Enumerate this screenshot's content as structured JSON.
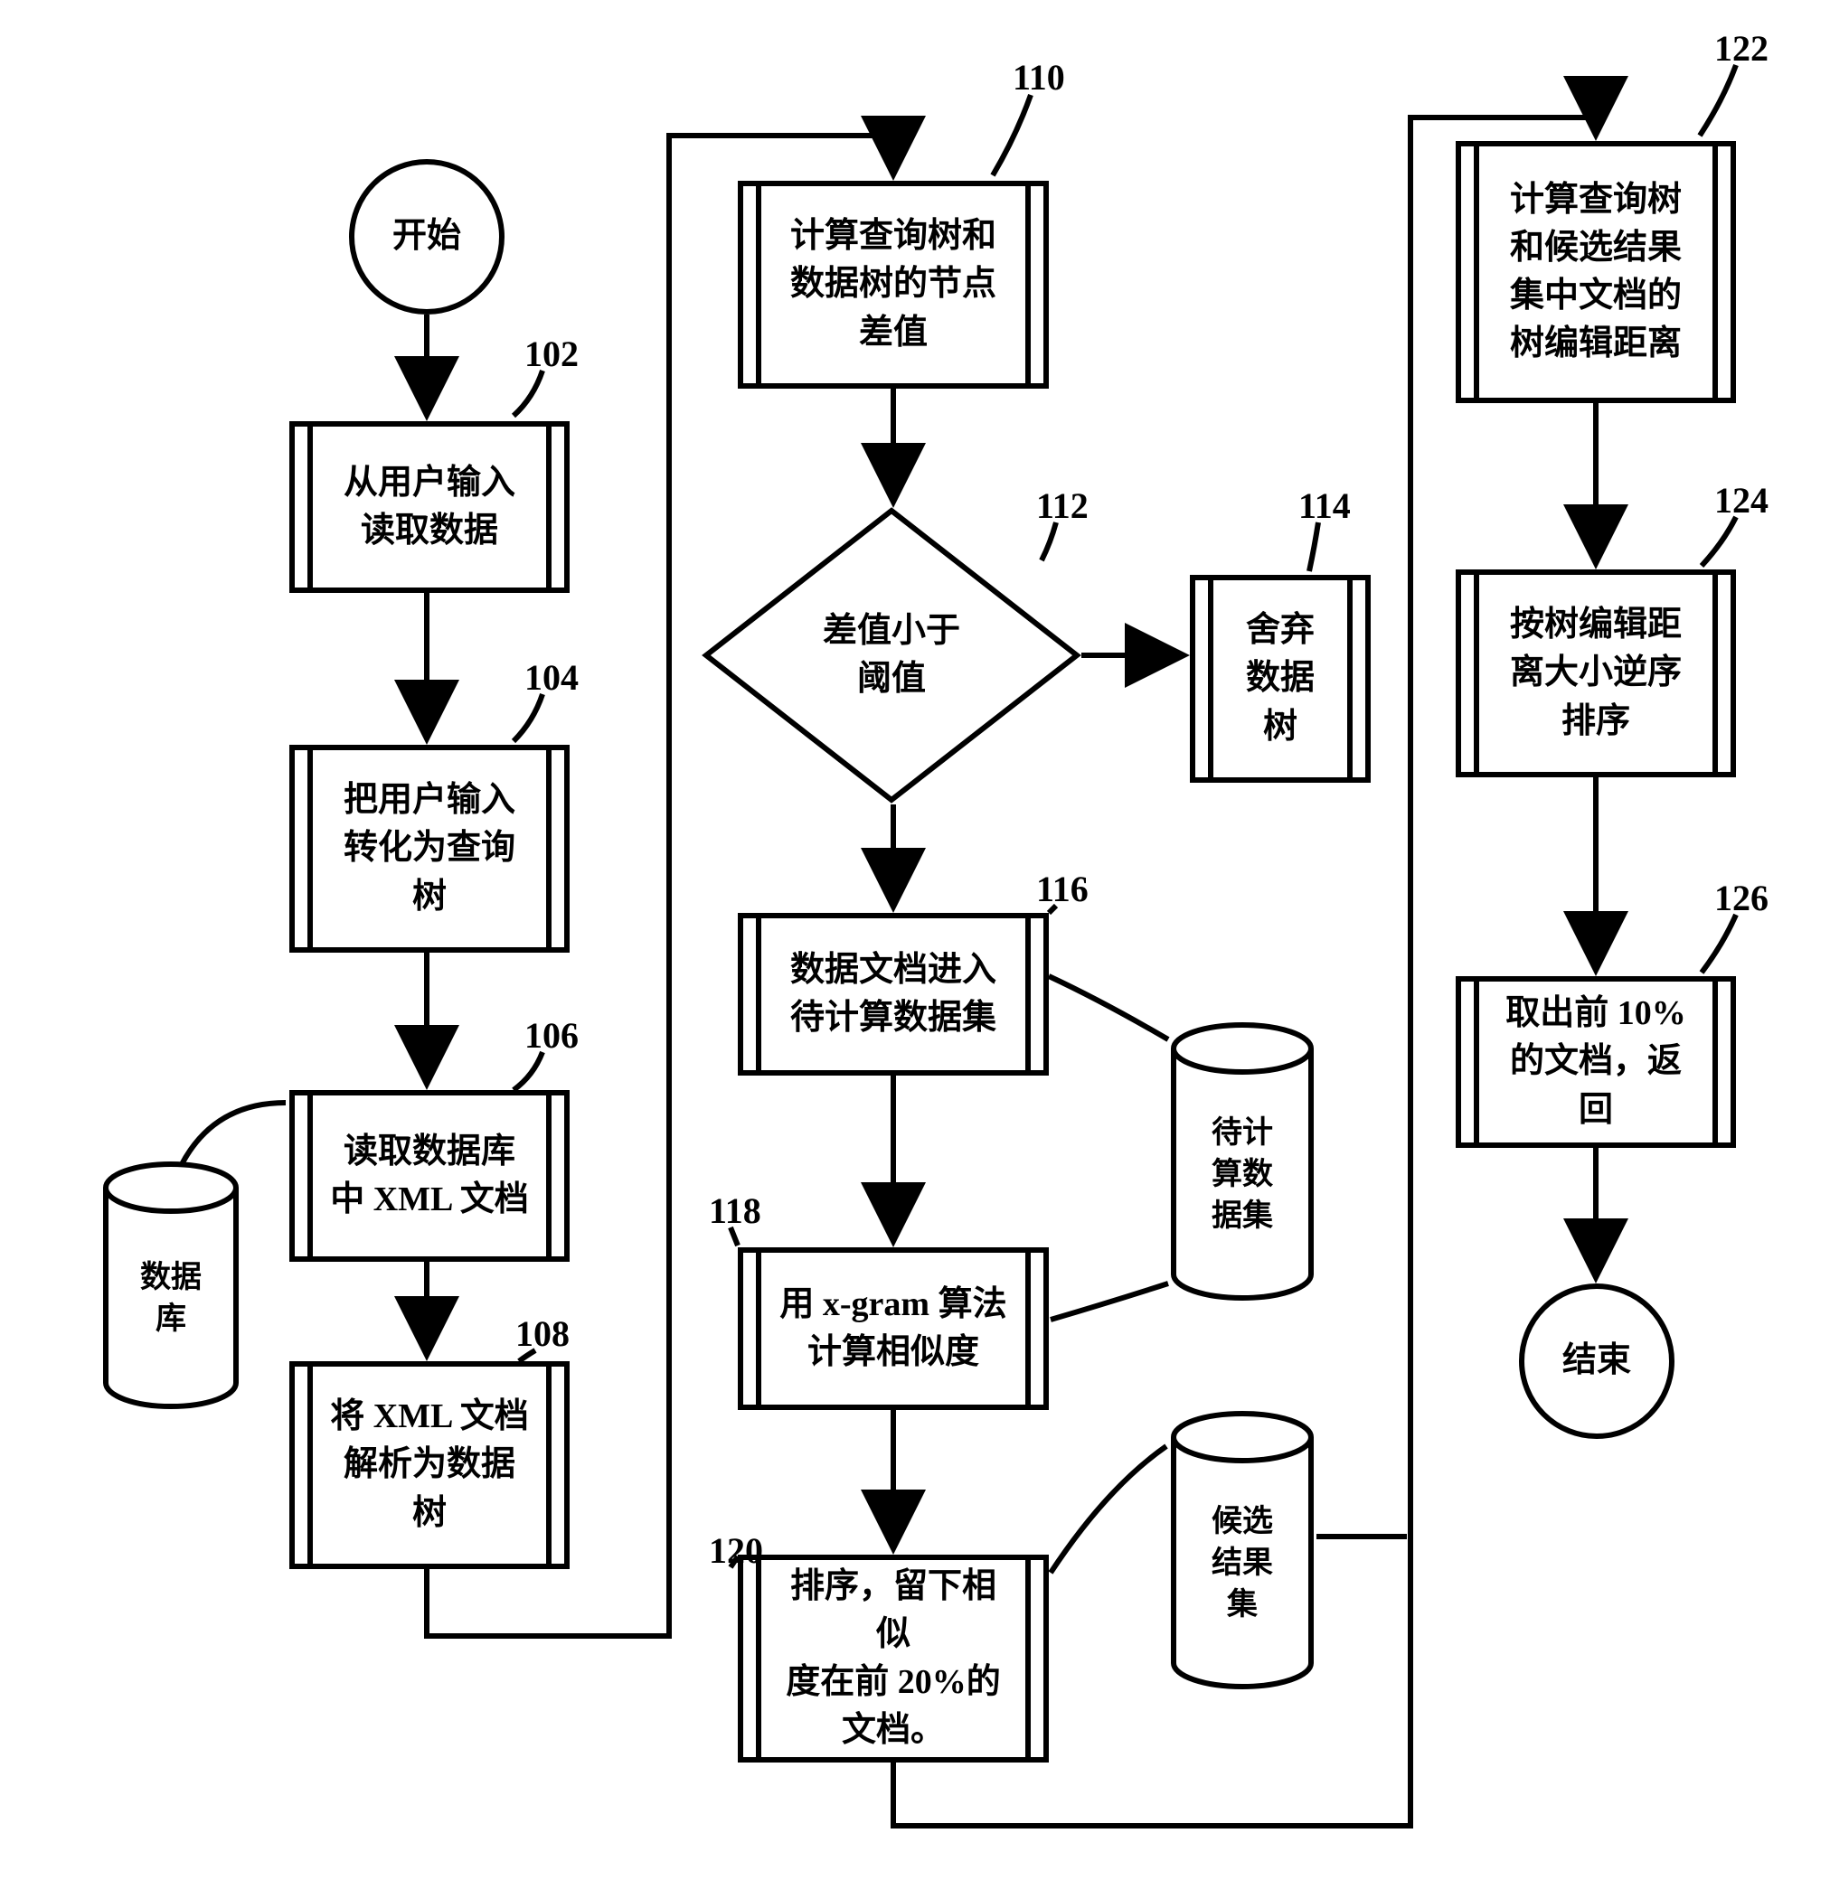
{
  "start": "开始",
  "end": "结束",
  "n102": {
    "text": "从用户输入\n读取数据",
    "ref": "102"
  },
  "n104": {
    "text": "把用户输入\n转化为查询\n树",
    "ref": "104"
  },
  "n106": {
    "text": "读取数据库\n中 XML 文档",
    "ref": "106"
  },
  "n108": {
    "text": "将 XML 文档\n解析为数据\n树",
    "ref": "108"
  },
  "n110": {
    "text": "计算查询树和\n数据树的节点\n差值",
    "ref": "110"
  },
  "n112": {
    "text": "差值小于\n阈值",
    "ref": "112"
  },
  "n114": {
    "text": "舍弃\n数据\n树",
    "ref": "114"
  },
  "n116": {
    "text": "数据文档进入\n待计算数据集",
    "ref": "116"
  },
  "n118": {
    "text": "用 x-gram 算法\n计算相似度",
    "ref": "118"
  },
  "n120": {
    "text": "排序，留下相似\n度在前 20%的\n文档。",
    "ref": "120"
  },
  "n122": {
    "text": "计算查询树\n和候选结果\n集中文档的\n树编辑距离",
    "ref": "122"
  },
  "n124": {
    "text": "按树编辑距\n离大小逆序\n排序",
    "ref": "124"
  },
  "n126": {
    "text": "取出前 10%\n的文档，返回",
    "ref": "126"
  },
  "db_main": "数据\n库",
  "db_pending": "待计\n算数\n据集",
  "db_cand": "候选\n结果\n集"
}
